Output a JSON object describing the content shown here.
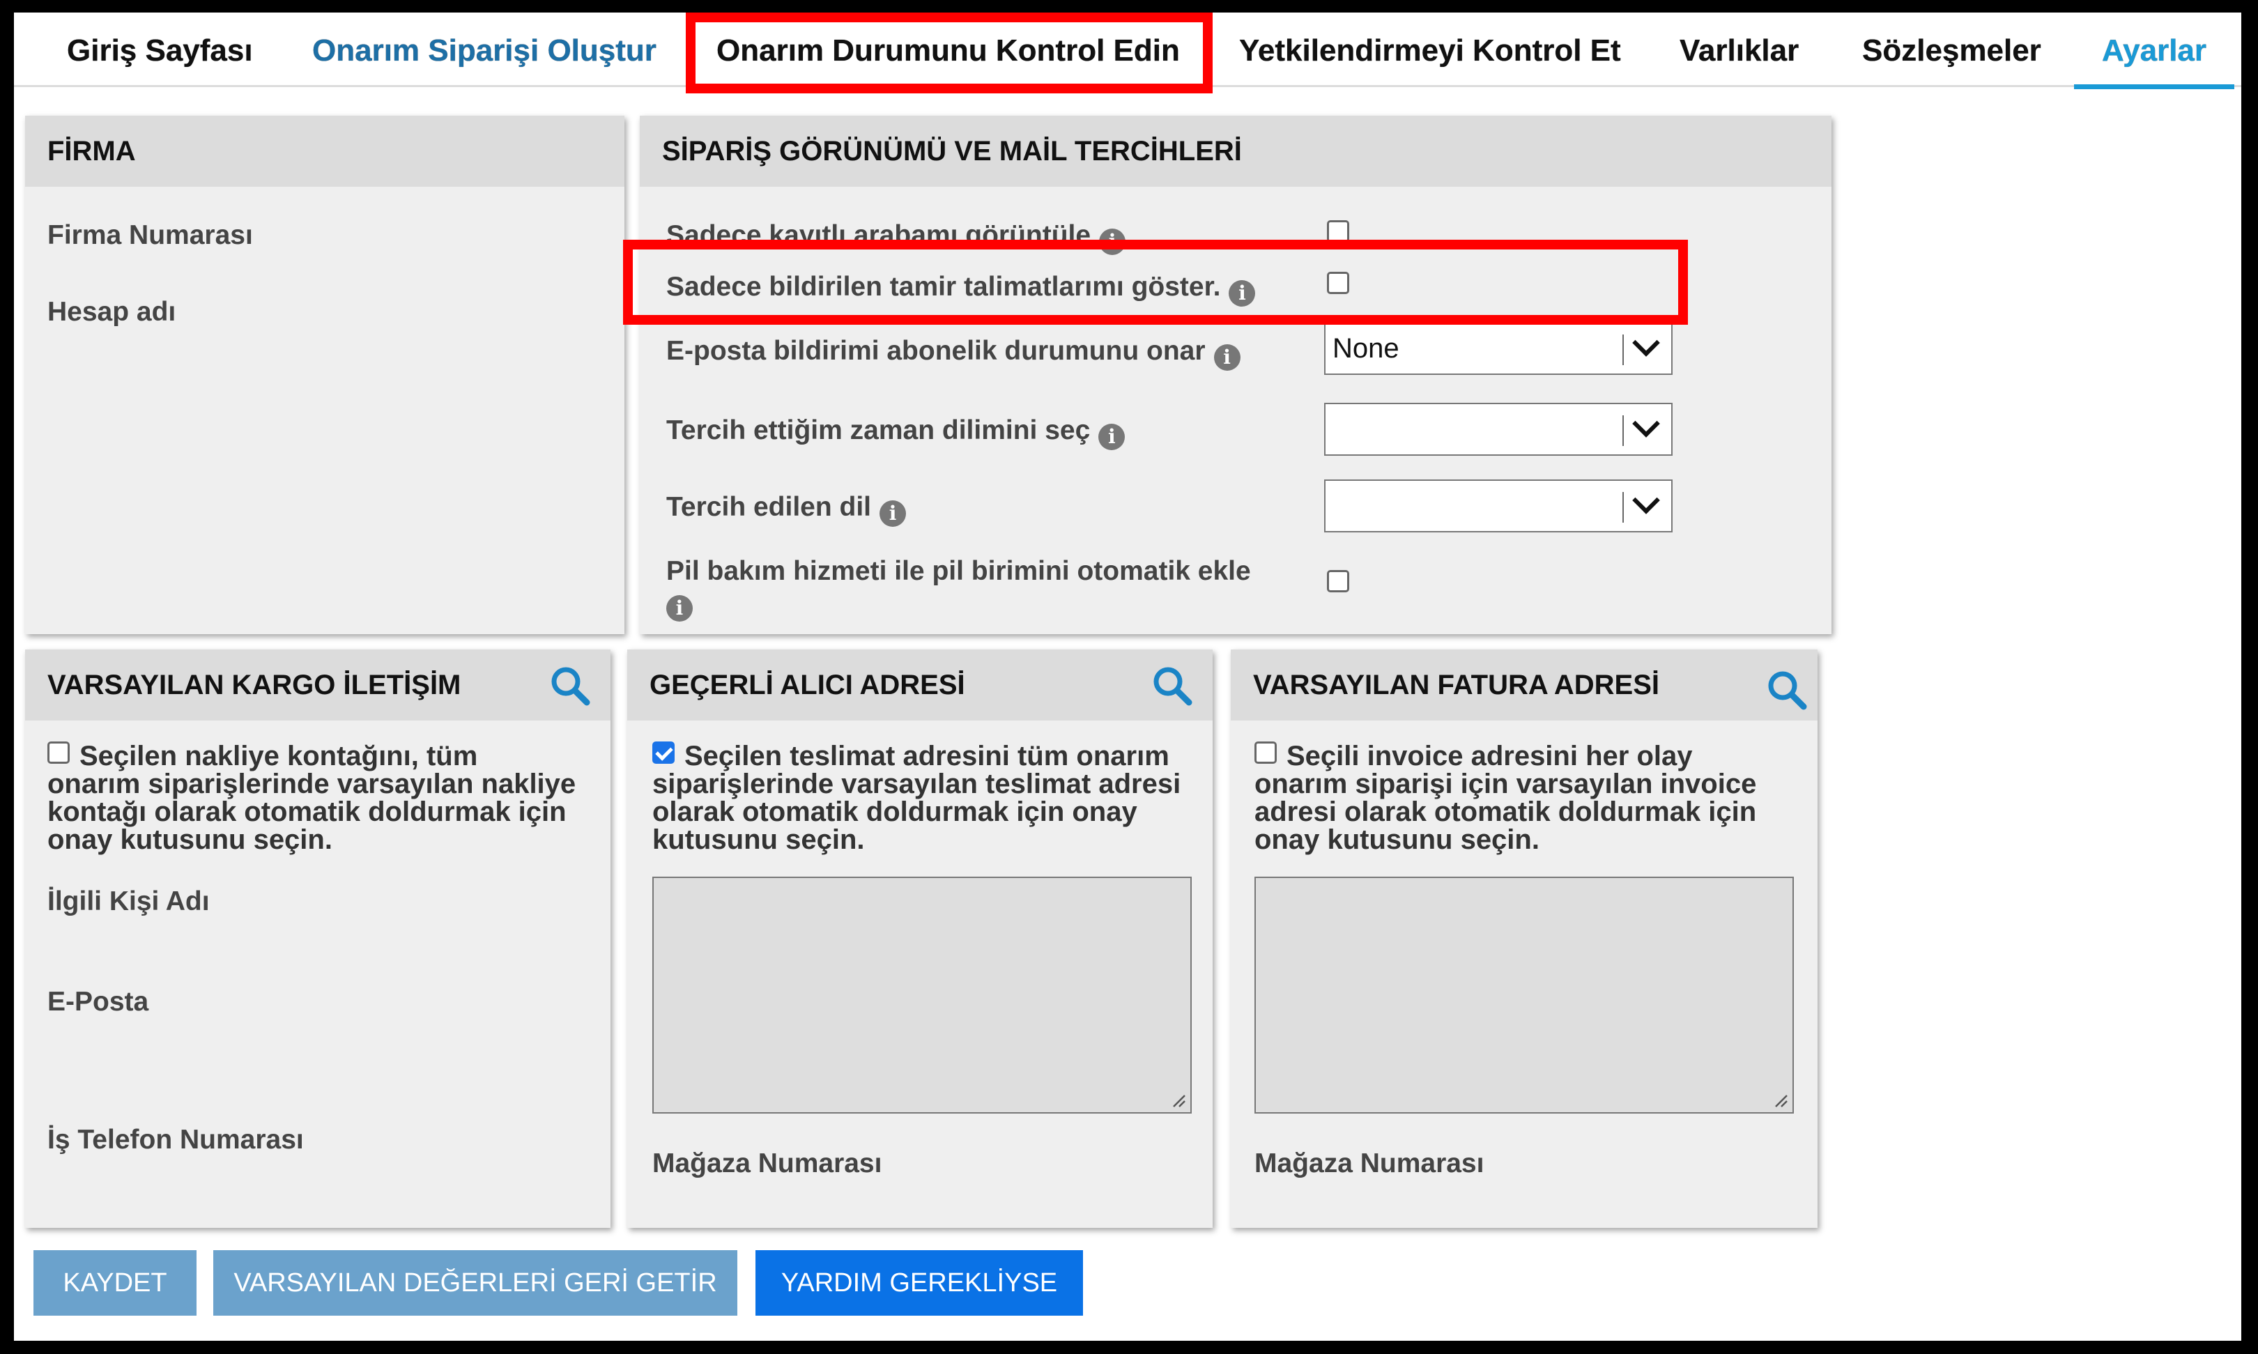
{
  "nav": {
    "tabs": [
      {
        "label": "Giriş Sayfası"
      },
      {
        "label": "Onarım Siparişi Oluştur"
      },
      {
        "label": "Onarım Durumunu Kontrol Edin"
      },
      {
        "label": "Yetkilendirmeyi Kontrol Et"
      },
      {
        "label": "Varlıklar"
      },
      {
        "label": "Sözleşmeler"
      },
      {
        "label": "Ayarlar"
      }
    ],
    "active_tab": "Ayarlar",
    "accent_color": "#1a9ad6"
  },
  "firma": {
    "title": "FİRMA",
    "firma_numarasi": "Firma Numarası",
    "hesap_adi": "Hesap adı"
  },
  "siparis": {
    "title": "SİPARİŞ GÖRÜNÜMÜ VE MAİL TERCİHLERİ",
    "only_my_cars": "Sadece kayıtlı arabamı görüntüle",
    "only_my_instructions": "Sadece bildirilen tamir talimatlarımı göster.",
    "email_status": "E-posta bildirimi abonelik durumunu onar",
    "email_status_value": "None",
    "timezone": "Tercih ettiğim zaman dilimini seç",
    "timezone_value": "",
    "language": "Tercih edilen dil",
    "language_value": "",
    "battery_1": "Pil bakım hizmeti ile pil birimini otomatik ekle",
    "info_glyph": "i"
  },
  "kargo": {
    "title": "VARSAYILAN KARGO İLETİŞİM",
    "desc_1": "Seçilen nakliye kontağını, tüm",
    "desc_2": "onarım siparişlerinde varsayılan nakliye",
    "desc_3": "kontağı olarak otomatik doldurmak için",
    "desc_4": "onay kutusunu seçin.",
    "checked": false,
    "contact_name": "İlgili Kişi Adı",
    "email": "E-Posta",
    "phone": "İş Telefon Numarası"
  },
  "alici": {
    "title": "GEÇERLİ ALICI ADRESİ",
    "desc_1": "Seçilen teslimat adresini tüm onarım",
    "desc_2": "siparişlerinde varsayılan teslimat adresi",
    "desc_3": "olarak otomatik doldurmak için onay",
    "desc_4": "kutusunu seçin.",
    "checked": true,
    "store_number": "Mağaza Numarası"
  },
  "fatura": {
    "title": "VARSAYILAN FATURA ADRESİ",
    "desc_1": "Seçili invoice adresini her olay",
    "desc_2": "onarım siparişi için varsayılan invoice",
    "desc_3": "adresi olarak otomatik doldurmak için",
    "desc_4": "onay kutusunu seçin.",
    "checked": false,
    "store_number": "Mağaza Numarası"
  },
  "buttons": {
    "save": "KAYDET",
    "reset": "VARSAYILAN DEĞERLERİ GERİ GETİR",
    "help": "YARDIM GEREKLİYSE"
  },
  "colors": {
    "highlight": "#ff0000",
    "button_light": "#6ba2cc",
    "button_dark": "#0a72e6"
  }
}
